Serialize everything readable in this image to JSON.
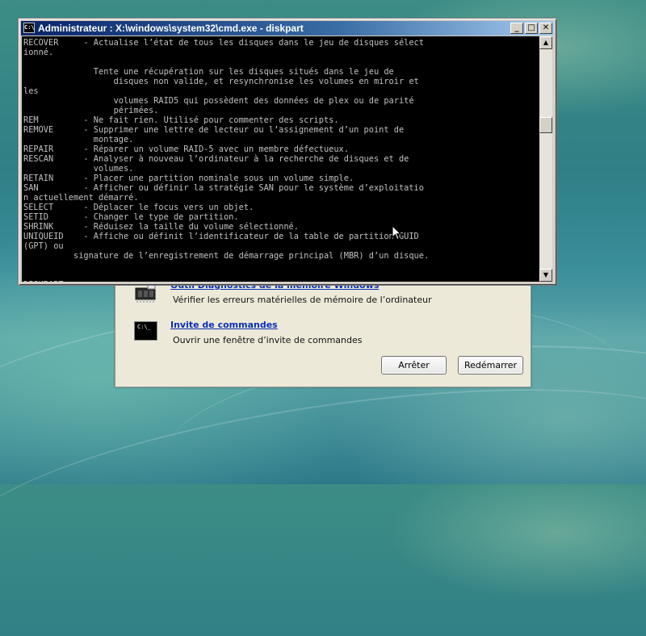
{
  "cmd_window": {
    "title": "Administrateur : X:\\windows\\system32\\cmd.exe - diskpart",
    "title_icon_text": "C:\\",
    "controls": {
      "minimize": "_",
      "maximize": "□",
      "close": "✕"
    },
    "console_lines": [
      "RECOVER     - Actualise l’état de tous les disques dans le jeu de disques sélect",
      "ionné.",
      "",
      "              Tente une récupération sur les disques situés dans le jeu de",
      "                  disques non valide, et resynchronise les volumes en miroir et",
      "les",
      "                  volumes RAID5 qui possèdent des données de plex ou de parité",
      "                  périmées.",
      "REM         - Ne fait rien. Utilisé pour commenter des scripts.",
      "REMOVE      - Supprimer une lettre de lecteur ou l’assignement d’un point de",
      "              montage.",
      "REPAIR      - Réparer un volume RAID-5 avec un membre défectueux.",
      "RESCAN      - Analyser à nouveau l’ordinateur à la recherche de disques et de",
      "              volumes.",
      "RETAIN      - Placer une partition nominale sous un volume simple.",
      "SAN         - Afficher ou définir la stratégie SAN pour le système d’exploitatio",
      "n actuellement démarré.",
      "SELECT      - Déplacer le focus vers un objet.",
      "SETID       - Changer le type de partition.",
      "SHRINK      - Réduisez la taille du volume sélectionné.",
      "UNIQUEID    - Affiche ou définit l’identificateur de la table de partition GUID",
      "(GPT) ou",
      "          signature de l’enregistrement de démarrage principal (MBR) d’un disque.",
      "",
      "",
      "DISKPART> "
    ]
  },
  "recovery_dialog": {
    "tools": [
      {
        "title": "Outil Diagnostics de la mémoire Windows",
        "description": "Vérifier les erreurs matérielles de mémoire de l’ordinateur",
        "icon": "memory-chip-icon"
      },
      {
        "title": "Invite de commandes",
        "description": "Ouvrir une fenêtre d’invite de commandes",
        "icon": "command-prompt-icon",
        "icon_text": "C:\\_"
      }
    ],
    "buttons": {
      "shutdown": "Arrêter",
      "restart": "Redémarrer"
    }
  }
}
